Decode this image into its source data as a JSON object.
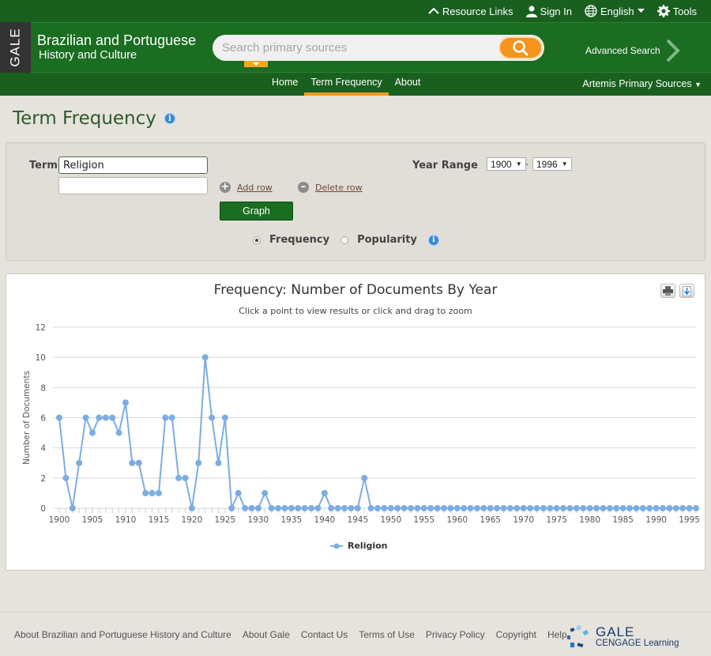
{
  "topbar": {
    "resource_links": "Resource Links",
    "sign_in": "Sign In",
    "language": "English",
    "tools": "Tools"
  },
  "brand": {
    "tab": "GALE",
    "title_line1": "Brazilian and Portuguese",
    "title_line2": "History and Culture"
  },
  "search": {
    "placeholder": "Search primary sources",
    "advanced": "Advanced Search"
  },
  "nav": {
    "items": [
      {
        "label": "Home",
        "active": false
      },
      {
        "label": "Term Frequency",
        "active": true
      },
      {
        "label": "About",
        "active": false
      }
    ],
    "right": "Artemis Primary Sources"
  },
  "page": {
    "title": "Term Frequency"
  },
  "form": {
    "term_label": "Term",
    "term_values": [
      "Religion",
      ""
    ],
    "add_row": "Add row",
    "delete_row": "Delete row",
    "graph_button": "Graph",
    "year_range_label": "Year Range",
    "year_from": "1900",
    "year_to": "1996",
    "year_sep": "-",
    "modes": [
      {
        "label": "Frequency",
        "selected": true
      },
      {
        "label": "Popularity",
        "selected": false
      }
    ]
  },
  "chart_data": {
    "type": "line",
    "title": "Frequency: Number of Documents By Year",
    "subtitle": "Click a point to view results or click and drag to zoom",
    "xlabel": "",
    "ylabel": "Number of Documents",
    "ylim": [
      0,
      12
    ],
    "yticks": [
      0,
      2,
      4,
      6,
      8,
      10,
      12
    ],
    "xlim": [
      1900,
      1996
    ],
    "xtick_labels": [
      "1900",
      "1905",
      "1910",
      "1915",
      "1920",
      "1925",
      "1930",
      "1935",
      "1940",
      "1945",
      "1950",
      "1955",
      "1960",
      "1965",
      "1970",
      "1975",
      "1980",
      "1985",
      "1990",
      "1995"
    ],
    "grid": true,
    "legend": "bottom-center",
    "color": "#7cade2",
    "series": [
      {
        "name": "Religion",
        "x_start": 1900,
        "values": [
          6,
          2,
          0,
          3,
          6,
          5,
          6,
          6,
          6,
          5,
          7,
          3,
          3,
          1,
          1,
          1,
          6,
          6,
          2,
          2,
          0,
          3,
          10,
          6,
          3,
          6,
          0,
          1,
          0,
          0,
          0,
          1,
          0,
          0,
          0,
          0,
          0,
          0,
          0,
          0,
          1,
          0,
          0,
          0,
          0,
          0,
          2,
          0,
          0,
          0,
          0,
          0,
          0,
          0,
          0,
          0,
          0,
          0,
          0,
          0,
          0,
          0,
          0,
          0,
          0,
          0,
          0,
          0,
          0,
          0,
          0,
          0,
          0,
          0,
          0,
          0,
          0,
          0,
          0,
          0,
          0,
          0,
          0,
          0,
          0,
          0,
          0,
          0,
          0,
          0,
          0,
          0,
          0,
          0,
          0,
          0,
          0
        ]
      }
    ]
  },
  "chart_tools": {
    "print": "print-icon",
    "download": "download-icon"
  },
  "footer": {
    "links": [
      "About Brazilian and Portuguese History and Culture",
      "About Gale",
      "Contact Us",
      "Terms of Use",
      "Privacy Policy",
      "Copyright",
      "Help"
    ],
    "logo_line1": "GALE",
    "logo_line2": "CENGAGE Learning"
  }
}
